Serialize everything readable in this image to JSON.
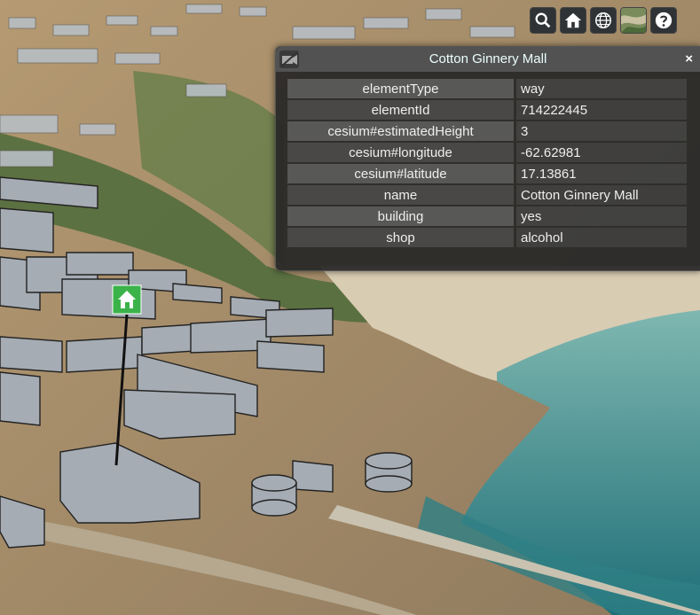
{
  "toolbar": {
    "buttons": [
      {
        "name": "search-icon"
      },
      {
        "name": "home-icon"
      },
      {
        "name": "globe-icon"
      },
      {
        "name": "imagery-layer-picker-icon"
      },
      {
        "name": "help-icon"
      }
    ]
  },
  "infobox": {
    "title": "Cotton Ginnery Mall",
    "close_label": "×",
    "camera_icon": "camera-track-icon",
    "properties": [
      {
        "key": "elementType",
        "value": "way"
      },
      {
        "key": "elementId",
        "value": "714222445"
      },
      {
        "key": "cesium#estimatedHeight",
        "value": "3"
      },
      {
        "key": "cesium#longitude",
        "value": "-62.62981"
      },
      {
        "key": "cesium#latitude",
        "value": "17.13861"
      },
      {
        "key": "name",
        "value": "Cotton Ginnery Mall"
      },
      {
        "key": "building",
        "value": "yes"
      },
      {
        "key": "shop",
        "value": "alcohol"
      }
    ]
  },
  "marker": {
    "icon": "home-icon",
    "color": "#3bb34a"
  },
  "colors": {
    "panel": "#262626",
    "sea": "#3f8f8f",
    "building": "#a5acb3"
  }
}
